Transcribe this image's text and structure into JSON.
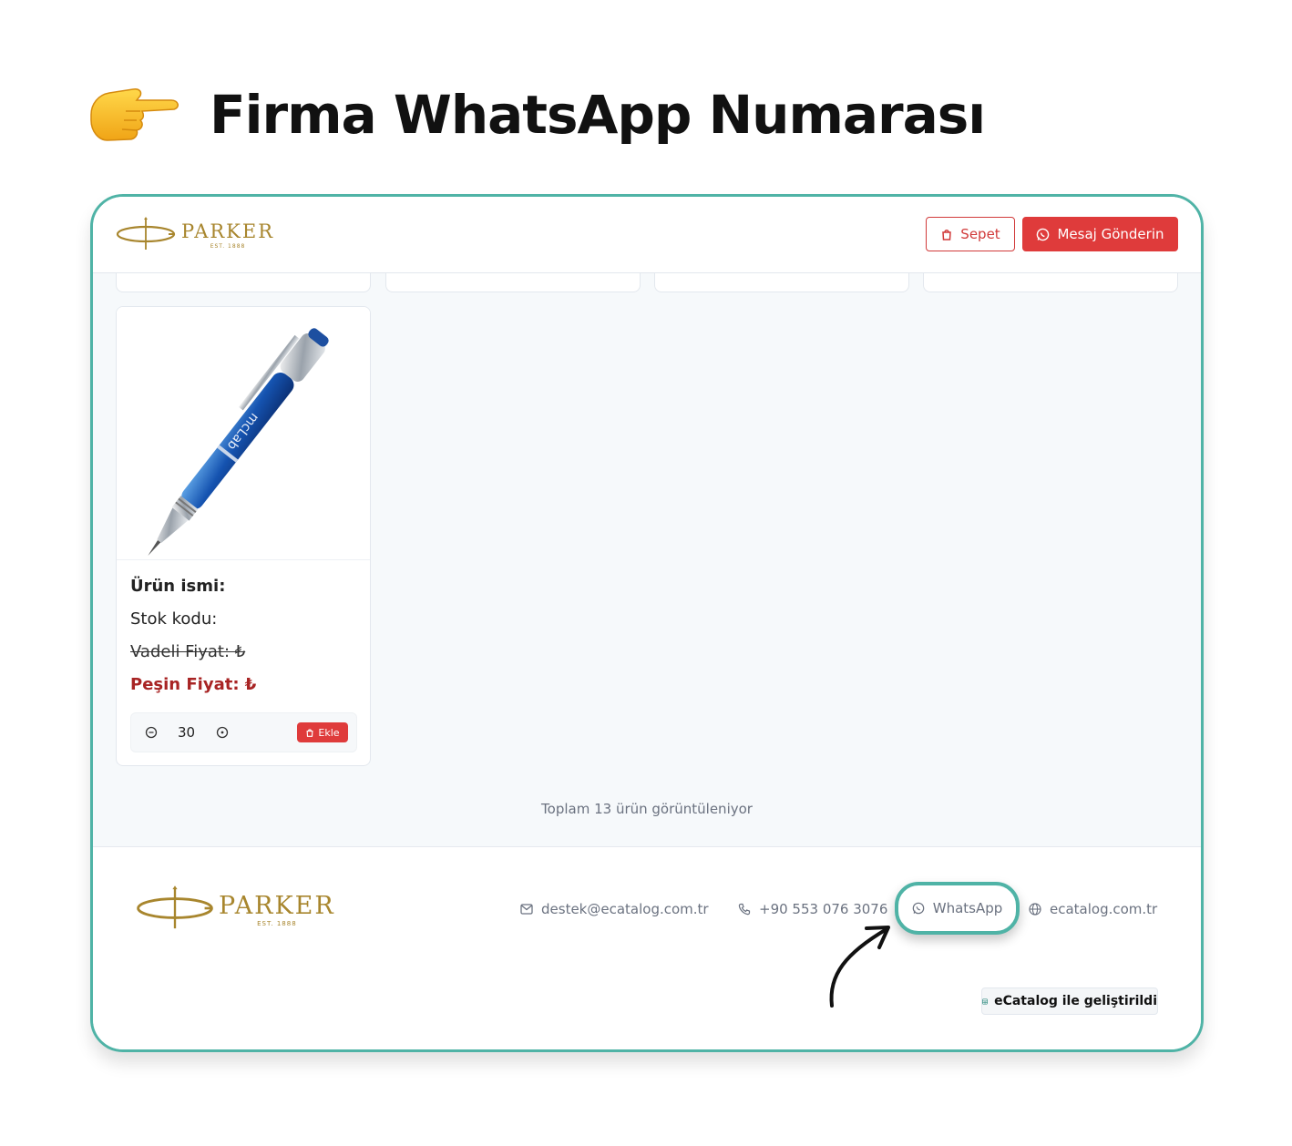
{
  "headline": {
    "pointer_icon": "backhand-index-pointing-right-icon",
    "text": "Firma WhatsApp Numarası"
  },
  "header": {
    "logo": {
      "word": "PARKER",
      "est": "EST. 1888"
    },
    "cart_label": "Sepet",
    "message_label": "Mesaj Gönderin"
  },
  "product": {
    "image_label": "mcLab",
    "name_label": "Ürün ismi:",
    "stock_label": "Stok kodu:",
    "term_price_label": "Vadeli Fiyat: ₺",
    "cash_price_label": "Peşin Fiyat: ₺",
    "quantity": "30",
    "add_label": "Ekle"
  },
  "listing": {
    "total_text": "Toplam 13 ürün görüntüleniyor"
  },
  "footer": {
    "logo": {
      "word": "PARKER",
      "est": "EST. 1888"
    },
    "email": "destek@ecatalog.com.tr",
    "phone": "+90 553 076 3076",
    "whatsapp": "WhatsApp",
    "website": "ecatalog.com.tr",
    "built_with": "eCatalog ile geliştirildi"
  },
  "colors": {
    "accent_teal": "#4fb3a6",
    "brand_red": "#df3b3b",
    "parker_gold": "#a8862e",
    "cash_price": "#a82424"
  }
}
